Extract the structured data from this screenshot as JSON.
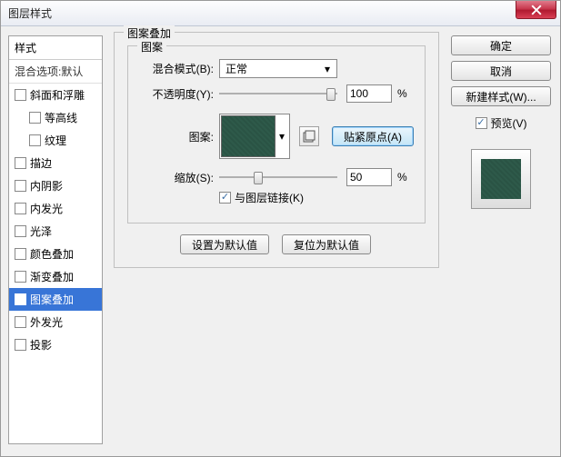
{
  "title": "图层样式",
  "sidebar": {
    "head": "样式",
    "sub": "混合选项:默认",
    "items": [
      {
        "label": "斜面和浮雕",
        "checked": false,
        "indent": false
      },
      {
        "label": "等高线",
        "checked": false,
        "indent": true
      },
      {
        "label": "纹理",
        "checked": false,
        "indent": true
      },
      {
        "label": "描边",
        "checked": false,
        "indent": false
      },
      {
        "label": "内阴影",
        "checked": false,
        "indent": false
      },
      {
        "label": "内发光",
        "checked": false,
        "indent": false
      },
      {
        "label": "光泽",
        "checked": false,
        "indent": false
      },
      {
        "label": "颜色叠加",
        "checked": false,
        "indent": false
      },
      {
        "label": "渐变叠加",
        "checked": false,
        "indent": false
      },
      {
        "label": "图案叠加",
        "checked": true,
        "indent": false,
        "selected": true
      },
      {
        "label": "外发光",
        "checked": false,
        "indent": false
      },
      {
        "label": "投影",
        "checked": false,
        "indent": false
      }
    ]
  },
  "panel": {
    "group_label": "图案叠加",
    "inner_label": "图案",
    "blend_label": "混合模式(B):",
    "blend_value": "正常",
    "opacity_label": "不透明度(Y):",
    "opacity_value": "100",
    "pct": "%",
    "pattern_label": "图案:",
    "snap_label": "贴紧原点(A)",
    "scale_label": "缩放(S):",
    "scale_value": "50",
    "link_label": "与图层链接(K)",
    "set_default": "设置为默认值",
    "reset_default": "复位为默认值"
  },
  "right": {
    "ok": "确定",
    "cancel": "取消",
    "new_style": "新建样式(W)...",
    "preview": "预览(V)"
  }
}
